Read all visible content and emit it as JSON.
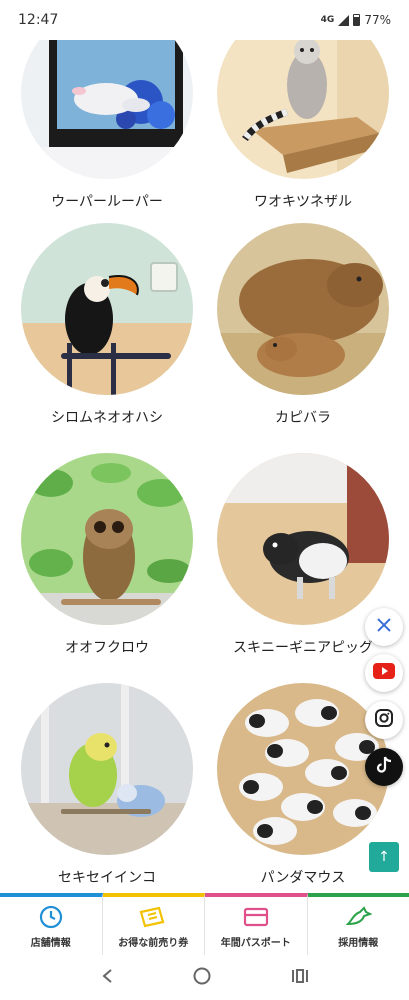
{
  "status_bar": {
    "time": "12:47",
    "network": "4G",
    "battery": "77%"
  },
  "animals": [
    {
      "name": "ウーパールーパー"
    },
    {
      "name": "ワオキツネザル"
    },
    {
      "name": "シロムネオオハシ"
    },
    {
      "name": "カピバラ"
    },
    {
      "name": "オオフクロウ"
    },
    {
      "name": "スキニーギニアピッグ"
    },
    {
      "name": "セキセイインコ"
    },
    {
      "name": "パンダマウス"
    }
  ],
  "social": [
    "x-icon",
    "youtube-icon",
    "instagram-icon",
    "tiktok-icon"
  ],
  "back_to_top": "↑",
  "bottom_nav": [
    {
      "label": "店舗情報",
      "icon": "clock-icon",
      "color": "#1f8fd6"
    },
    {
      "label": "お得な前売り券",
      "icon": "ticket-icon",
      "color": "#f2c200"
    },
    {
      "label": "年間パスポート",
      "icon": "card-icon",
      "color": "#e0508a"
    },
    {
      "label": "採用情報",
      "icon": "bird-icon",
      "color": "#2ca24a"
    }
  ]
}
